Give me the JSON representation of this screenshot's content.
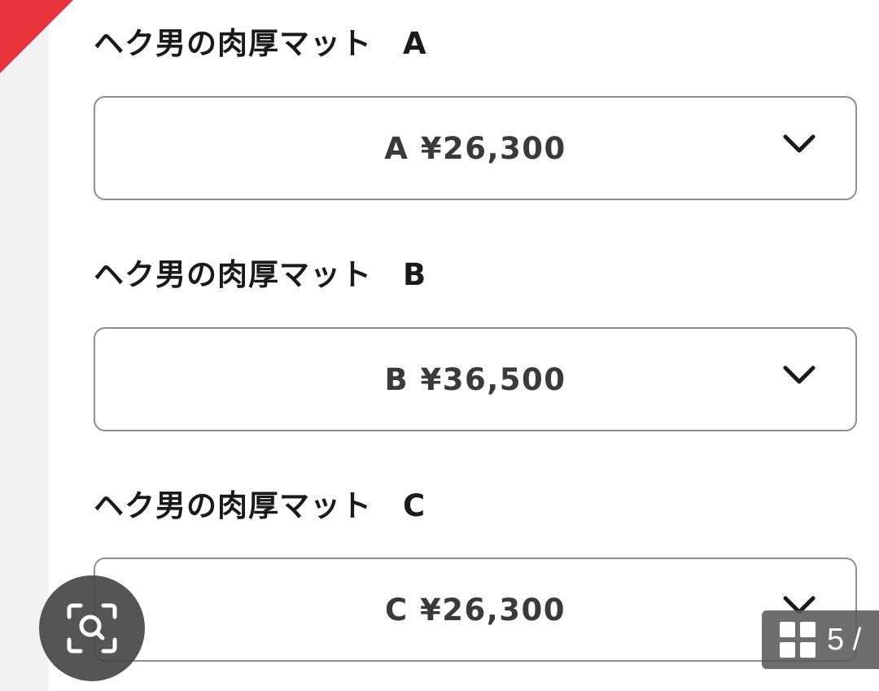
{
  "options": [
    {
      "label": "ヘク男の肉厚マット　A",
      "selected": "A ¥26,300"
    },
    {
      "label": "ヘク男の肉厚マット　B",
      "selected": "B ¥36,500"
    },
    {
      "label": "ヘク男の肉厚マット　C",
      "selected": "C ¥26,300"
    }
  ],
  "gallery": {
    "counter": "5 /"
  },
  "icons": {
    "dropdown": "chevron-down-icon",
    "visual_search": "lens-search-icon",
    "gallery": "grid-icon"
  },
  "colors": {
    "ribbon": "#e8323c",
    "border": "#8e8e93",
    "text": "#1a1a1a"
  }
}
